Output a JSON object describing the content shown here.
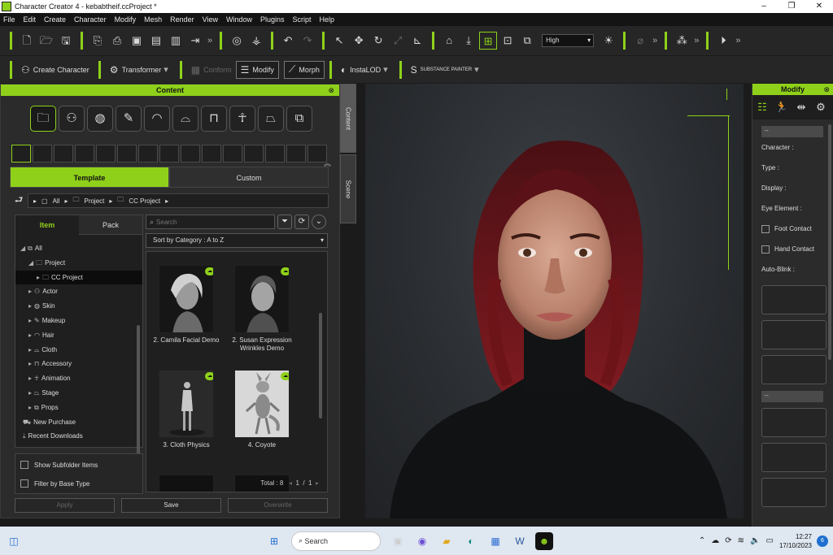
{
  "window": {
    "title": "Character Creator 4 - kebabtheif.ccProject *",
    "controls": [
      "–",
      "❐",
      "✕"
    ]
  },
  "menu": [
    "File",
    "Edit",
    "Create",
    "Character",
    "Modify",
    "Mesh",
    "Render",
    "View",
    "Window",
    "Plugins",
    "Script",
    "Help"
  ],
  "toolbar1": {
    "quality": "High"
  },
  "toolbar2": {
    "create_character": "Create Character",
    "transformer": "Transformer",
    "conform": "Conform",
    "modify": "Modify",
    "morph": "Morph",
    "instalod": "InstaLOD",
    "substance": "SUBSTANCE PAINTER"
  },
  "content": {
    "title": "Content",
    "tabs": [
      "Template",
      "Custom"
    ],
    "breadcrumb": [
      "All",
      "Project",
      "CC Project"
    ],
    "tree_tabs": [
      "Item",
      "Pack"
    ],
    "tree": [
      {
        "label": "All",
        "indent": 0
      },
      {
        "label": "Project",
        "indent": 1
      },
      {
        "label": "CC Project",
        "indent": 2
      },
      {
        "label": "Actor",
        "indent": 1
      },
      {
        "label": "Skin",
        "indent": 1
      },
      {
        "label": "Makeup",
        "indent": 1
      },
      {
        "label": "Hair",
        "indent": 1
      },
      {
        "label": "Cloth",
        "indent": 1
      },
      {
        "label": "Accessory",
        "indent": 1
      },
      {
        "label": "Animation",
        "indent": 1
      },
      {
        "label": "Stage",
        "indent": 1
      },
      {
        "label": "Props",
        "indent": 1
      },
      {
        "label": "New Purchase",
        "indent": 0
      },
      {
        "label": "Recent Downloads",
        "indent": 0
      }
    ],
    "search_placeholder": "Search",
    "sort": "Sort by Category : A to Z",
    "items": [
      {
        "label": "2. Camila Facial Demo"
      },
      {
        "label": "2. Susan Expression Wrinkles Demo"
      },
      {
        "label": "3. Cloth Physics"
      },
      {
        "label": "4. Coyote"
      }
    ],
    "total": "Total : 8",
    "page": "1",
    "pages": "1",
    "options": [
      "Show Subfolder Items",
      "Filter by Base Type"
    ],
    "buttons": [
      "Apply",
      "Save",
      "Overwrite"
    ],
    "side_tabs": [
      "Content",
      "Scene"
    ]
  },
  "modify": {
    "title": "Modify",
    "section": "--",
    "section2": "--",
    "character": "Character :",
    "type": "Type :",
    "display": "Display :",
    "eye": "Eye Element :",
    "foot": "Foot Contact",
    "hand": "Hand Contact",
    "blink": "Auto-Blink :"
  },
  "taskbar": {
    "search": "Search",
    "time": "12:27",
    "date": "17/10/2023",
    "badge": "6"
  }
}
